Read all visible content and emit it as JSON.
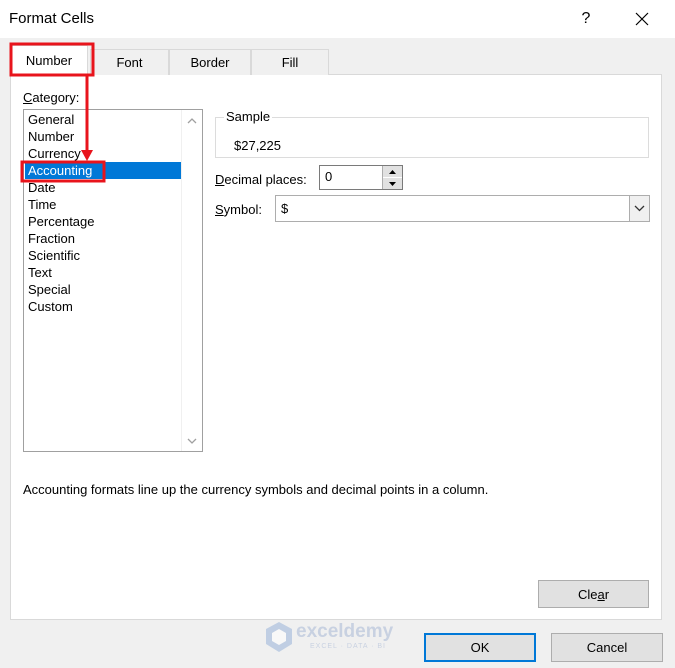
{
  "window": {
    "title": "Format Cells",
    "help": "?"
  },
  "tabs": [
    {
      "label": "Number",
      "active": true
    },
    {
      "label": "Font",
      "active": false
    },
    {
      "label": "Border",
      "active": false
    },
    {
      "label": "Fill",
      "active": false
    }
  ],
  "category": {
    "label_u": "C",
    "label_rest": "ategory:",
    "items": [
      "General",
      "Number",
      "Currency",
      "Accounting",
      "Date",
      "Time",
      "Percentage",
      "Fraction",
      "Scientific",
      "Text",
      "Special",
      "Custom"
    ],
    "selected": "Accounting"
  },
  "sample": {
    "legend": "Sample",
    "value": "$27,225"
  },
  "decimal_places": {
    "label_u": "D",
    "label_rest": "ecimal places:",
    "value": "0"
  },
  "symbol": {
    "label_u": "S",
    "label_rest": "ymbol:",
    "value": "$"
  },
  "description": "Accounting formats line up the currency symbols and decimal points in a column.",
  "buttons": {
    "clear_pre": "Cle",
    "clear_u": "a",
    "clear_post": "r",
    "ok": "OK",
    "cancel": "Cancel"
  },
  "watermark": {
    "name": "exceldemy",
    "tagline": "EXCEL · DATA · BI"
  },
  "colors": {
    "selection": "#0078d7",
    "annotation": "#e8141c",
    "window": "#f0f0f0"
  },
  "icons": [
    "close-icon",
    "scroll-up-icon",
    "scroll-down-icon",
    "spin-up-icon",
    "spin-down-icon",
    "dropdown-arrow-icon",
    "exceldemy-logo-icon"
  ]
}
